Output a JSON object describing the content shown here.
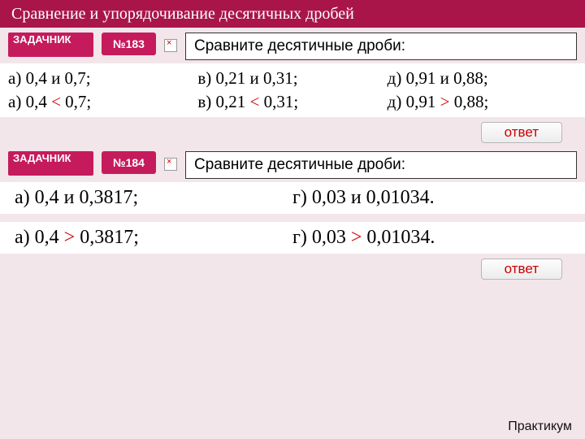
{
  "title": "Сравнение и упорядочивание десятичных дробей",
  "zadachnik_label": "ЗАДАЧНИК",
  "footer": "Практикум",
  "task1": {
    "num": "№183",
    "instruction": "Сравните десятичные дроби:",
    "problems": {
      "a": "а)  0,4  и  0,7;",
      "v": "в)  0,21  и  0,31;",
      "d": "д)  0,91  и  0,88;"
    },
    "answers": {
      "a_pre": "а)  0,4 ",
      "a_op": "<",
      "a_post": "  0,7;",
      "v_pre": "в)  0,21 ",
      "v_op": "<",
      "v_post": "  0,31;",
      "d_pre": "д)  0,91 ",
      "d_op": ">",
      "d_post": " 0,88;"
    },
    "answer_btn": "ответ"
  },
  "task2": {
    "num": "№184",
    "instruction": "Сравните десятичные дроби:",
    "problems": {
      "a": "а)  0,4  и  0,3817;",
      "g": "г)  0,03  и  0,01034."
    },
    "answers": {
      "a_pre": "а)  0,4 ",
      "a_op": ">",
      "a_post": " 0,3817;",
      "g_pre": "г)  0,03 ",
      "g_op": ">",
      "g_post": " 0,01034."
    },
    "answer_btn": "ответ"
  }
}
